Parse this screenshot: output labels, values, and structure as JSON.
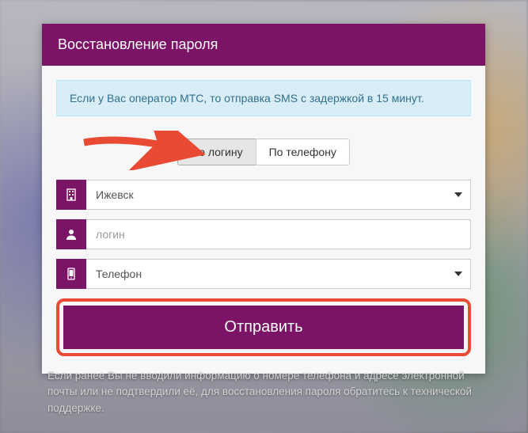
{
  "header": {
    "title": "Восстановление пароля"
  },
  "info": {
    "text": "Если у Вас оператор МТС, то отправка SMS с задержкой в 15 минут."
  },
  "tabs": {
    "login": "По логину",
    "phone": "По телефону"
  },
  "fields": {
    "city": {
      "value": "Ижевск"
    },
    "login": {
      "placeholder": "логин"
    },
    "phone": {
      "value": "Телефон"
    }
  },
  "submit": {
    "label": "Отправить"
  },
  "footer": {
    "text": "Если ранее Вы не вводили информацию о номере телефона и адресе электронной почты или не подтвердили её, для восстановления пароля обратитесь к технической поддержке."
  },
  "colors": {
    "brand": "#7b1466",
    "highlight": "#e84a33",
    "info_bg": "#d9edf7"
  }
}
